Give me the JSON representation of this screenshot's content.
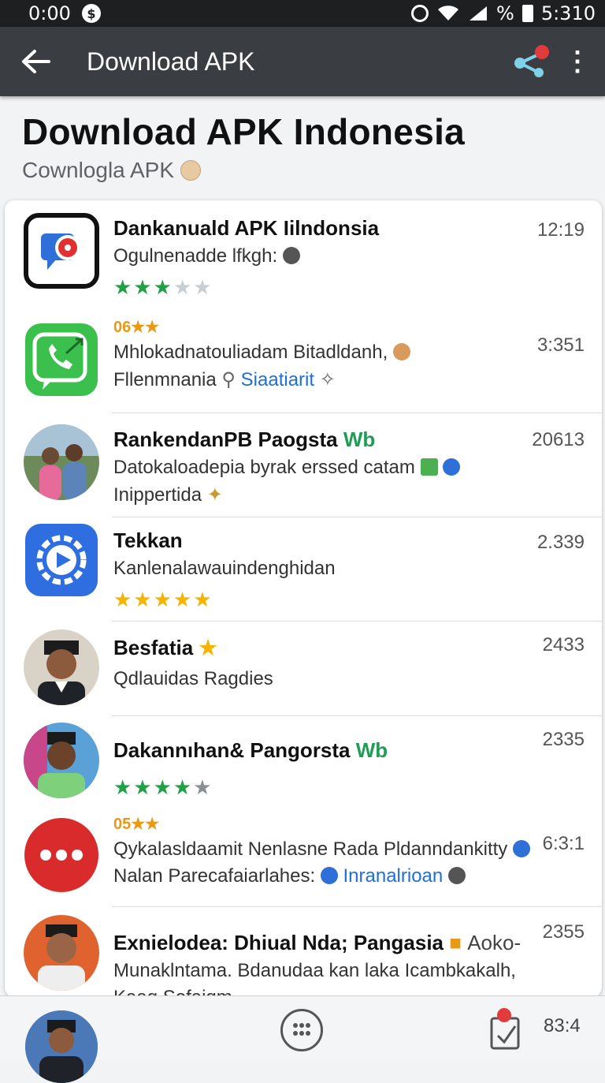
{
  "status_bar": {
    "time_left": "0:00",
    "coin": "$",
    "percent": "%",
    "time_right": "5:310"
  },
  "app_bar": {
    "title": "Download APK"
  },
  "hero": {
    "title": "Download APK Indonesia",
    "subtitle": "Cownlogla APK"
  },
  "list": [
    {
      "title": "Dankanuald APK Iilndonsia",
      "line1": "Ogulnenadde lfkgh:",
      "rating": 3,
      "time": "12:19"
    },
    {
      "badge": "06★★",
      "line1": "Mhlokadnatouliadam Bitadldanh,",
      "line2_a": "Fllenmnania",
      "line2_link": "Siaatiarit",
      "time": "3:351"
    },
    {
      "title": "RankendanPB Paogsta",
      "title_tag": "Wb",
      "line1": "Datokaloadepia byrak erssed catam",
      "line2_a": "Inippertida",
      "time": "20613"
    },
    {
      "title": "Tekkan",
      "line1": "Kanlenalawauindenghidan",
      "rating": 5,
      "time": "2.339"
    },
    {
      "title": "Besfatia",
      "line1": "Qdlauidas Ragdies",
      "time": "2433"
    },
    {
      "title": "Dakannıhan& Pangorsta",
      "title_tag": "Wb",
      "rating": 4,
      "time": "2335"
    },
    {
      "badge": "05★★",
      "line1": "Qykalasldaamit Nenlasne Rada Pldanndankitty",
      "line2_a": "Nalan Parecafaiarlahes:",
      "line2_link": "Inranalrioan",
      "time": "6:3:1"
    },
    {
      "title": "Exnielodea: Dhiual Nda; Pangasia",
      "title_extra": "Aoko-",
      "line1": "Munaklntama. Bdanudaa kan laka Icambkakalh,",
      "line2_a": "Kaag Sofaigm",
      "time": "2355"
    }
  ],
  "bottom_bar": {
    "count": "83:4"
  },
  "colors": {
    "app_bar": "#3a3d41",
    "green": "#1f9d55",
    "blue_link": "#1e6fd9",
    "badge": "#e89a16"
  }
}
